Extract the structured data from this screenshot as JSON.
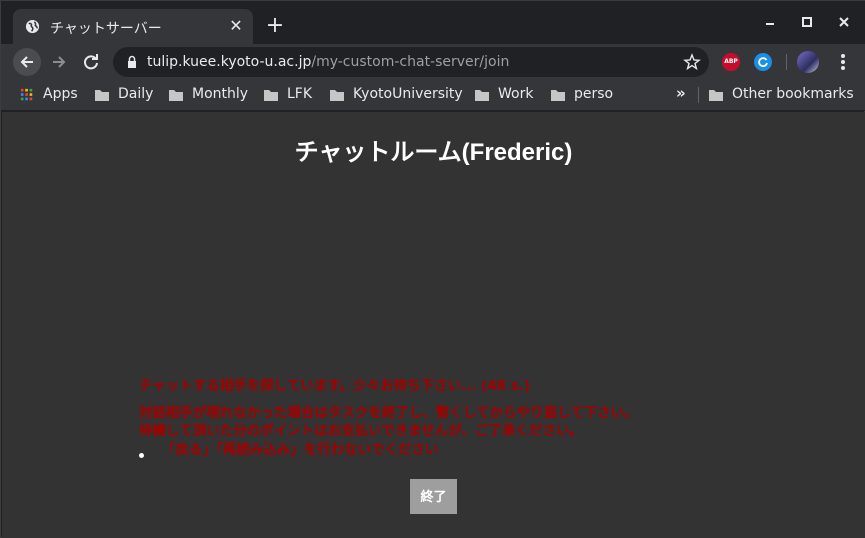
{
  "browser": {
    "tab": {
      "title": "チャットサーバー"
    },
    "window_controls": {
      "close": "✕"
    },
    "new_tab": "+",
    "address": {
      "host": "tulip.kuee.kyoto-u.ac.jp",
      "path": "/my-custom-chat-server/join"
    },
    "extensions": {
      "abp": "ABP"
    },
    "bookmarks": [
      {
        "label": "Apps",
        "icon": "apps-grid-icon"
      },
      {
        "label": "Daily",
        "icon": "folder-icon"
      },
      {
        "label": "Monthly",
        "icon": "folder-icon"
      },
      {
        "label": "LFK",
        "icon": "folder-icon"
      },
      {
        "label": "KyotoUniversity",
        "icon": "folder-icon"
      },
      {
        "label": "Work",
        "icon": "folder-icon"
      },
      {
        "label": "perso",
        "icon": "folder-icon"
      }
    ],
    "overflow": "»",
    "other_bookmarks": "Other bookmarks"
  },
  "page": {
    "heading": "チャットルーム(Frederic)",
    "status_message": "チャットする相手を探しています。少々お待ち下さい... (48 s.)",
    "notice_line1": "対話相手が現れなかった場合はタスクを終了し、暫くしてからやり直して下さい。",
    "notice_line2": "待機して頂いた分のポイントはお支払いできませんが、ご了承ください。",
    "warning_item": "「戻る」「再読み込み」を行わないでください",
    "end_button": "終了"
  },
  "colors": {
    "page_background": "#333333",
    "message_red": "#a40000",
    "button_gray": "#9e9e9e"
  }
}
